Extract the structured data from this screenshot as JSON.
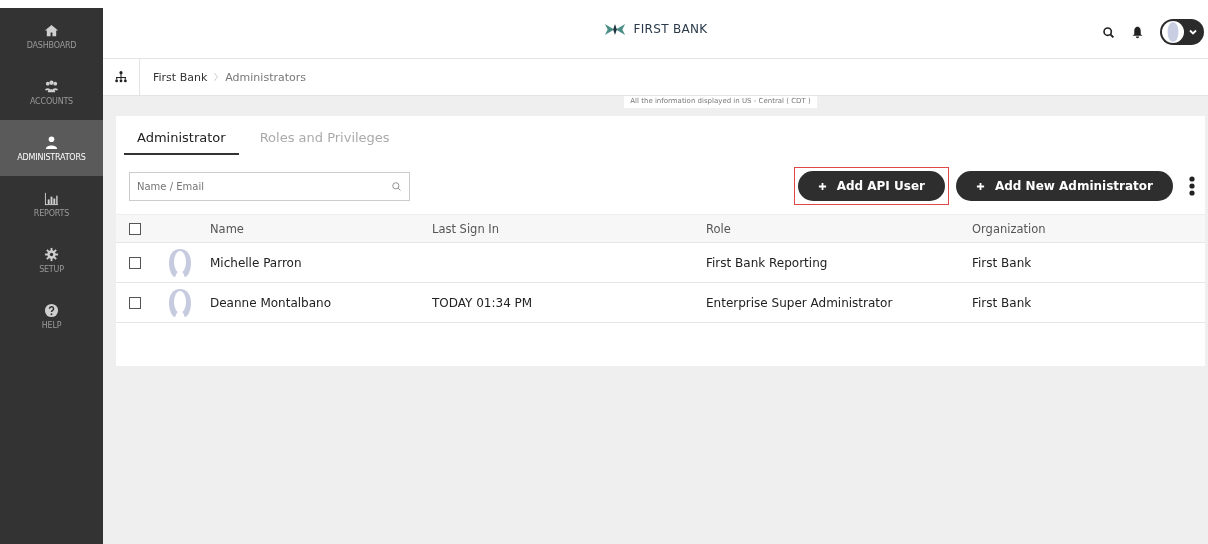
{
  "sidebar": {
    "items": [
      {
        "label": "DASHBOARD",
        "selected": false
      },
      {
        "label": "ACCOUNTS",
        "selected": false
      },
      {
        "label": "ADMINISTRATORS",
        "selected": true
      },
      {
        "label": "REPORTS",
        "selected": false
      },
      {
        "label": "SETUP",
        "selected": false
      },
      {
        "label": "HELP",
        "selected": false
      }
    ]
  },
  "header": {
    "brand": "FIRST BANK"
  },
  "breadcrumb": [
    "First Bank",
    "Administrators"
  ],
  "timezone_note": "All the information displayed in US - Central ( CDT )",
  "tabs": [
    {
      "label": "Administrator",
      "selected": true
    },
    {
      "label": "Roles and Privileges",
      "selected": false
    }
  ],
  "search": {
    "placeholder": "Name / Email"
  },
  "buttons": [
    {
      "label": "Add API User",
      "highlighted": true
    },
    {
      "label": "Add New Administrator",
      "highlighted": false
    }
  ],
  "table": {
    "columns": [
      "Name",
      "Last Sign In",
      "Role",
      "Organization"
    ],
    "all_checked": false,
    "rows": [
      {
        "checked": false,
        "name": "Michelle Parron",
        "role": "First Bank Reporting",
        "organization": "First Bank"
      },
      {
        "checked": false,
        "name": "Deanne Montalbano",
        "last_sign_in": "TODAY 01:34 PM",
        "role": "Enterprise Super Administrator",
        "organization": "First Bank"
      }
    ]
  }
}
